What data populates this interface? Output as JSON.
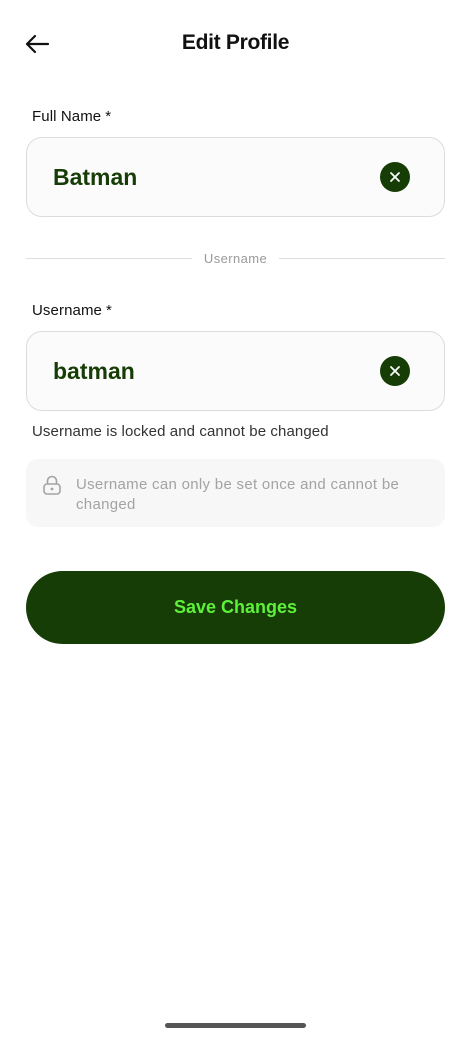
{
  "header": {
    "title": "Edit Profile",
    "back_icon": "arrow-left-icon"
  },
  "full_name": {
    "label": "Full Name",
    "required_mark": "*",
    "value": "Batman",
    "clear_icon": "close-icon"
  },
  "divider": {
    "label": "Username"
  },
  "username": {
    "label": "Username",
    "required_mark": "*",
    "value": "batman",
    "clear_icon": "close-icon",
    "helper_text": "Username is locked and cannot be changed"
  },
  "info": {
    "icon": "lock-icon",
    "text": "Username can only be set once and cannot be changed"
  },
  "actions": {
    "save_label": "Save Changes"
  },
  "colors": {
    "primary": "#163d06",
    "accent_text": "#5ef03a",
    "muted_text": "#a3a3a3"
  }
}
